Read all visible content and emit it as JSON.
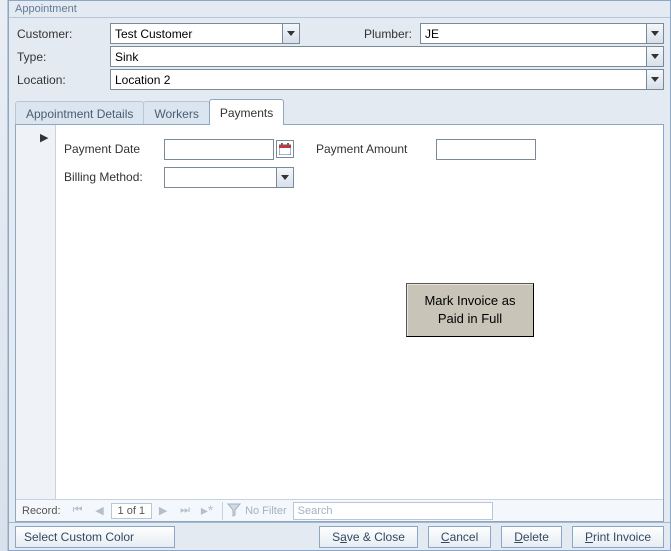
{
  "window": {
    "title": "Appointment"
  },
  "form": {
    "customer": {
      "label": "Customer:",
      "value": "Test Customer"
    },
    "plumber": {
      "label": "Plumber:",
      "value": "JE"
    },
    "type": {
      "label": "Type:",
      "value": "Sink"
    },
    "location": {
      "label": "Location:",
      "value": "Location 2"
    }
  },
  "tabs": {
    "0": {
      "label": "Appointment Details"
    },
    "1": {
      "label": "Workers"
    },
    "2": {
      "label": "Payments"
    }
  },
  "payments": {
    "payment_date": {
      "label": "Payment Date",
      "value": ""
    },
    "payment_amount": {
      "label": "Payment Amount",
      "value": ""
    },
    "billing_method": {
      "label": "Billing Method:",
      "value": ""
    },
    "mark_paid_button": "Mark Invoice as Paid in Full"
  },
  "recordnav": {
    "label": "Record:",
    "counter": "1 of 1",
    "filter_text": "No Filter",
    "search_placeholder": "Search"
  },
  "buttons": {
    "color": "Select Custom Color",
    "save": {
      "p": "S",
      "u": "a",
      "s": "ve & Close"
    },
    "cancel": {
      "p": "",
      "u": "C",
      "s": "ancel"
    },
    "delete": {
      "p": "",
      "u": "D",
      "s": "elete"
    },
    "print": {
      "p": "",
      "u": "P",
      "s": "rint Invoice"
    }
  }
}
